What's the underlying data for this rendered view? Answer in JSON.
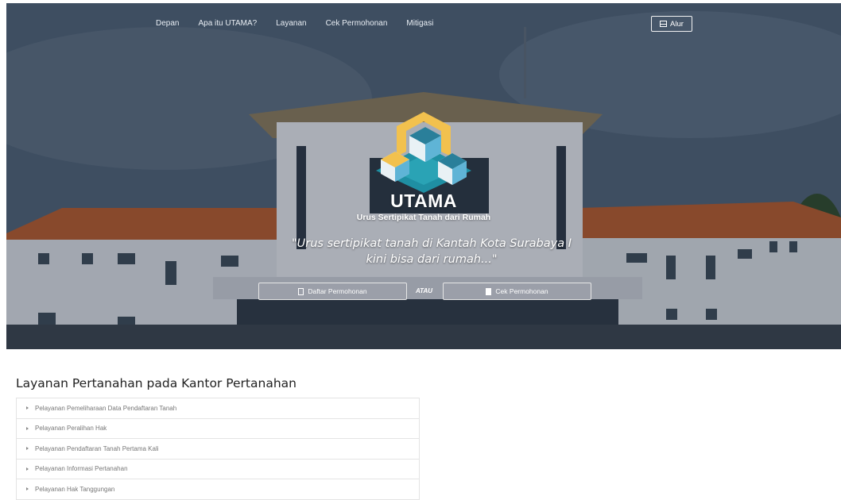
{
  "nav": {
    "items": [
      "Depan",
      "Apa itu UTAMA?",
      "Layanan",
      "Cek Permohonan",
      "Mitigasi"
    ],
    "alur_label": "Alur"
  },
  "hero": {
    "logo_title": "UTAMA",
    "logo_subtitle": "Urus Sertipikat Tanah dari Rumah",
    "quote_line1": "\"Urus sertipikat tanah di Kantah Kota Surabaya I",
    "quote_line2": "kini bisa dari rumah...\"",
    "btn_daftar": "Daftar Permohonan",
    "separator": "ATAU",
    "btn_cek": "Cek Permohonan"
  },
  "services": {
    "title": "Layanan Pertanahan pada Kantor Pertanahan",
    "items": [
      "Pelayanan Pemeliharaan Data Pendaftaran Tanah",
      "Pelayanan Peralihan Hak",
      "Pelayanan Pendaftaran Tanah Pertama Kali",
      "Pelayanan Informasi Pertanahan",
      "Pelayanan Hak Tanggungan"
    ]
  },
  "colors": {
    "logo_yellow": "#f2c14e",
    "logo_teal": "#1f8fa3",
    "logo_blue": "#5fb4d6",
    "roof_orange": "#c8652f"
  }
}
